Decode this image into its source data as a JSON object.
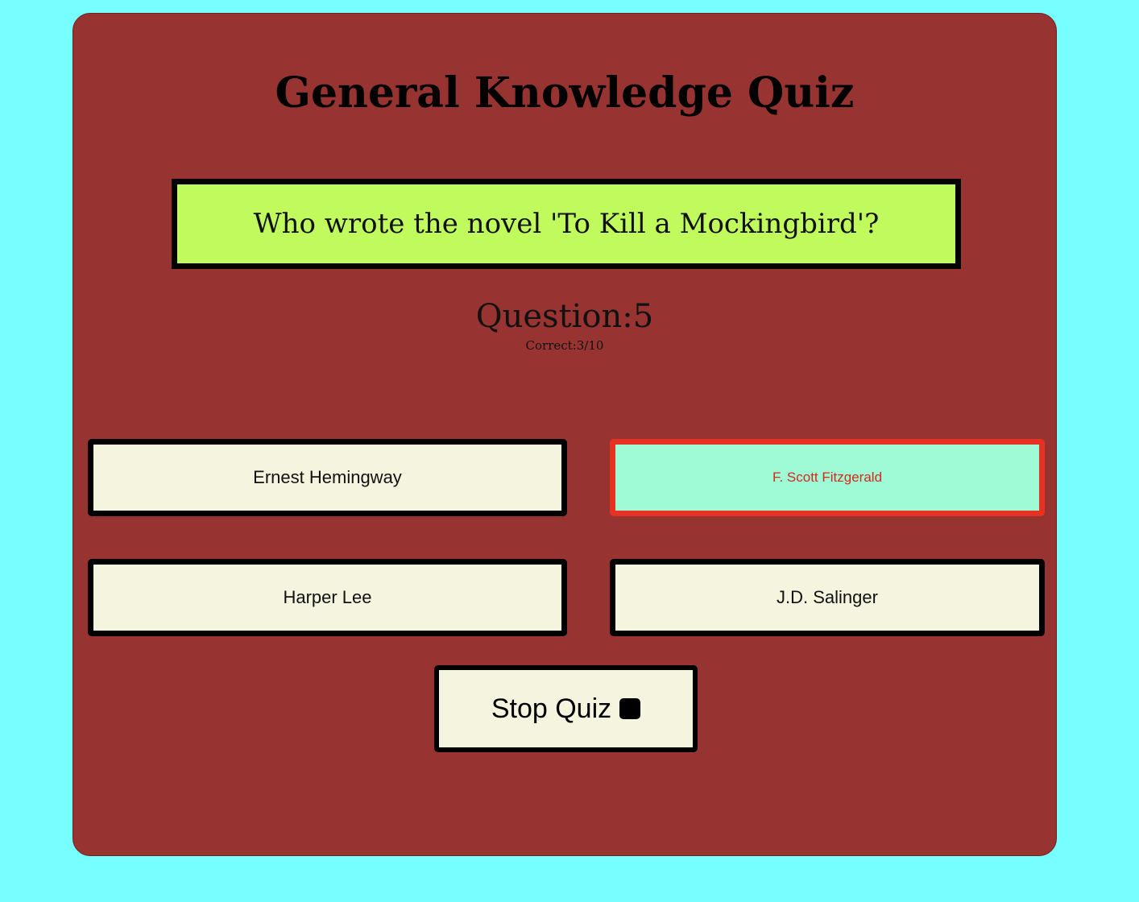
{
  "quiz": {
    "title": "General Knowledge Quiz",
    "question": "Who wrote the novel 'To Kill a Mockingbird'?",
    "question_number": "Question:5",
    "correct_count": "Correct:3/10",
    "answers": [
      {
        "label": "Ernest Hemingway",
        "selected": false
      },
      {
        "label": "F. Scott Fitzgerald",
        "selected": true
      },
      {
        "label": "Harper Lee",
        "selected": false
      },
      {
        "label": "J.D. Salinger",
        "selected": false
      }
    ],
    "stop_label": "Stop Quiz",
    "stop_icon": "stop-square-icon"
  },
  "colors": {
    "page_background": "#77ffff",
    "card_background": "#973431",
    "question_background": "#c0fa5d",
    "answer_background": "#f4f4df",
    "selected_answer_background": "#9ffad6",
    "selected_answer_border": "#e63223",
    "selected_answer_text": "#d42a1c"
  }
}
